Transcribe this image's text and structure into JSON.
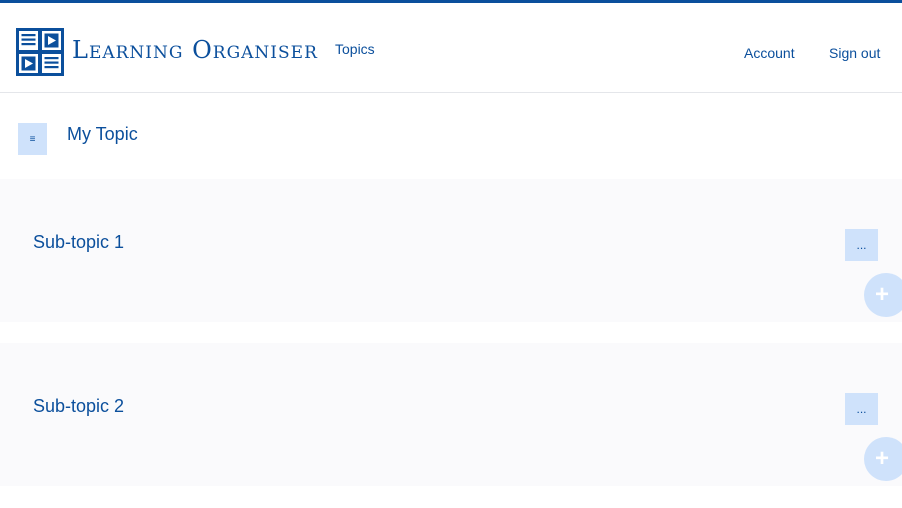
{
  "header": {
    "brand": "Learning Organiser",
    "nav": {
      "topics": "Topics",
      "account": "Account",
      "sign_out": "Sign out"
    }
  },
  "topic": {
    "menu_icon": "≡",
    "title": "My Topic"
  },
  "subtopics": [
    {
      "title": "Sub-topic 1",
      "more_label": "...",
      "add_label": "+"
    },
    {
      "title": "Sub-topic 2",
      "more_label": "...",
      "add_label": "+"
    }
  ],
  "colors": {
    "brand": "#0b4f9c",
    "button_bg": "#cfe2fb",
    "card_bg": "#fafafc"
  },
  "icons": {
    "logo": "learning-organiser-logo-icon",
    "menu": "hamburger-menu-icon",
    "more": "ellipsis-icon",
    "add": "plus-icon"
  }
}
